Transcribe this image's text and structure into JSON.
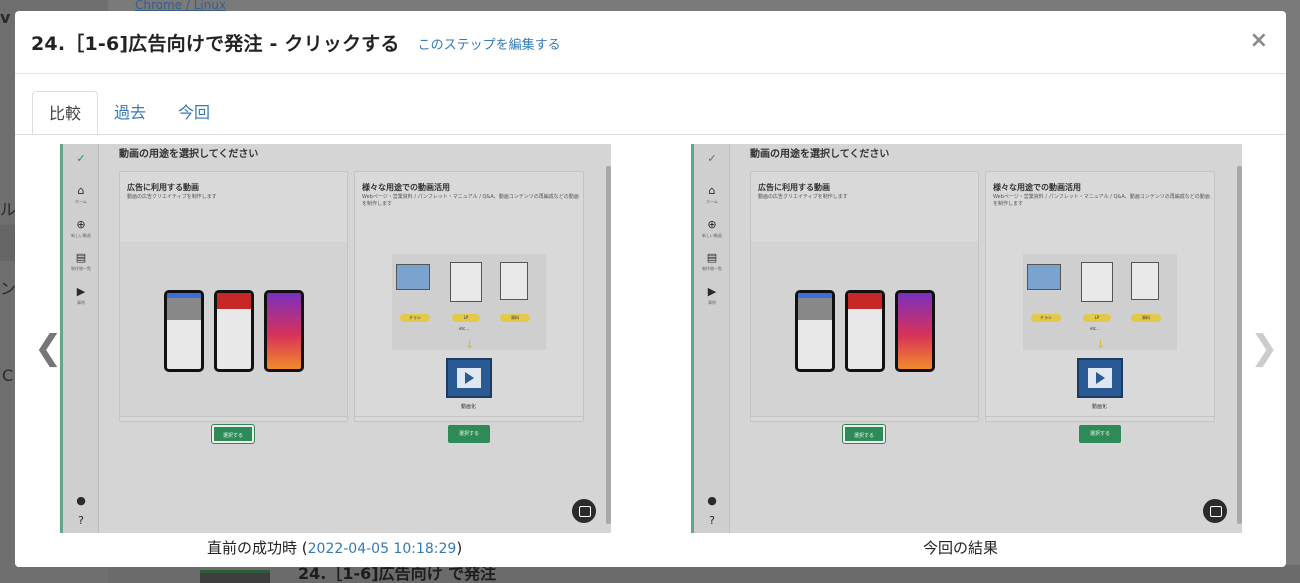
{
  "background": {
    "link_text": "Chrome / Linux",
    "fragments": [
      "v",
      "ル",
      "ン",
      "C"
    ],
    "bottom_step": "24.［1-6]広告向け で発注"
  },
  "modal": {
    "title": "24.［1-6]広告向けで発注 - クリックする",
    "edit_link": "このステップを編集する",
    "close_label": "×"
  },
  "tabs": [
    {
      "label": "比較",
      "active": true
    },
    {
      "label": "過去",
      "active": false
    },
    {
      "label": "今回",
      "active": false
    }
  ],
  "nav": {
    "prev": "❮",
    "next": "❯"
  },
  "screenshot": {
    "heading": "動画の用途を選択してください",
    "card1": {
      "title": "広告に利用する動画",
      "subtitle": "動画の広告クリエイティブを制作します",
      "button": "選択する"
    },
    "card2": {
      "title": "様々な用途での動画活用",
      "subtitle": "Webページ・営業資料 / パンフレット・マニュアル / Q&A、動画コンテンツの再編成などの動画を制作します",
      "pills": [
        "チラシ",
        "LP",
        "資料"
      ],
      "etc": "etc...",
      "film_label": "動画化",
      "button": "選択する"
    },
    "sidebar_labels": [
      "ホーム",
      "新しい動画",
      "制作物一覧",
      "事例"
    ]
  },
  "captions": {
    "left_prefix": "直前の成功時 (",
    "left_timestamp": "2022-04-05 10:18:29",
    "left_suffix": ")",
    "right": "今回の結果"
  },
  "icons": {
    "close": "close-icon",
    "prev": "chevron-left-icon",
    "next": "chevron-right-icon"
  },
  "colors": {
    "link": "#337ab7",
    "accent_green": "#5fa889",
    "select_button": "#2e8b57"
  }
}
